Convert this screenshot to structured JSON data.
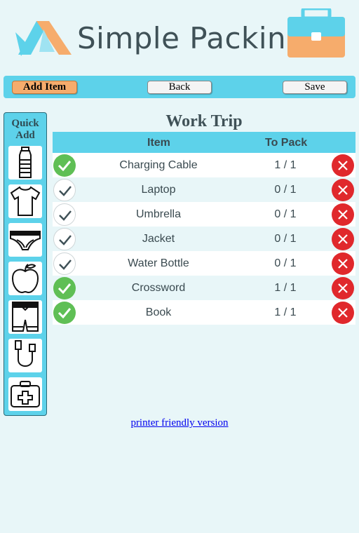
{
  "app": {
    "title": "Simple Packing"
  },
  "toolbar": {
    "add_label": "Add Item",
    "back_label": "Back",
    "save_label": "Save"
  },
  "quick_add": {
    "title": "Quick Add",
    "items": [
      {
        "icon": "water-bottle-icon"
      },
      {
        "icon": "t-shirt-icon"
      },
      {
        "icon": "underwear-icon"
      },
      {
        "icon": "apple-icon"
      },
      {
        "icon": "swim-shorts-icon"
      },
      {
        "icon": "usb-cable-icon"
      },
      {
        "icon": "first-aid-kit-icon"
      }
    ]
  },
  "list": {
    "title": "Work Trip",
    "columns": {
      "item": "Item",
      "to_pack": "To Pack"
    },
    "rows": [
      {
        "name": "Charging Cable",
        "packed": "1 / 1",
        "done": true
      },
      {
        "name": "Laptop",
        "packed": "0 / 1",
        "done": false
      },
      {
        "name": "Umbrella",
        "packed": "0 / 1",
        "done": false
      },
      {
        "name": "Jacket",
        "packed": "0 / 1",
        "done": false
      },
      {
        "name": "Water Bottle",
        "packed": "0 / 1",
        "done": false
      },
      {
        "name": "Crossword",
        "packed": "1 / 1",
        "done": true
      },
      {
        "name": "Book",
        "packed": "1 / 1",
        "done": true
      }
    ]
  },
  "footer": {
    "printer_link": "printer friendly version"
  },
  "colors": {
    "accent": "#5dd2ea",
    "orange": "#f6ac6c",
    "done": "#5fbf55",
    "delete": "#e0282c",
    "text": "#3f5157"
  }
}
